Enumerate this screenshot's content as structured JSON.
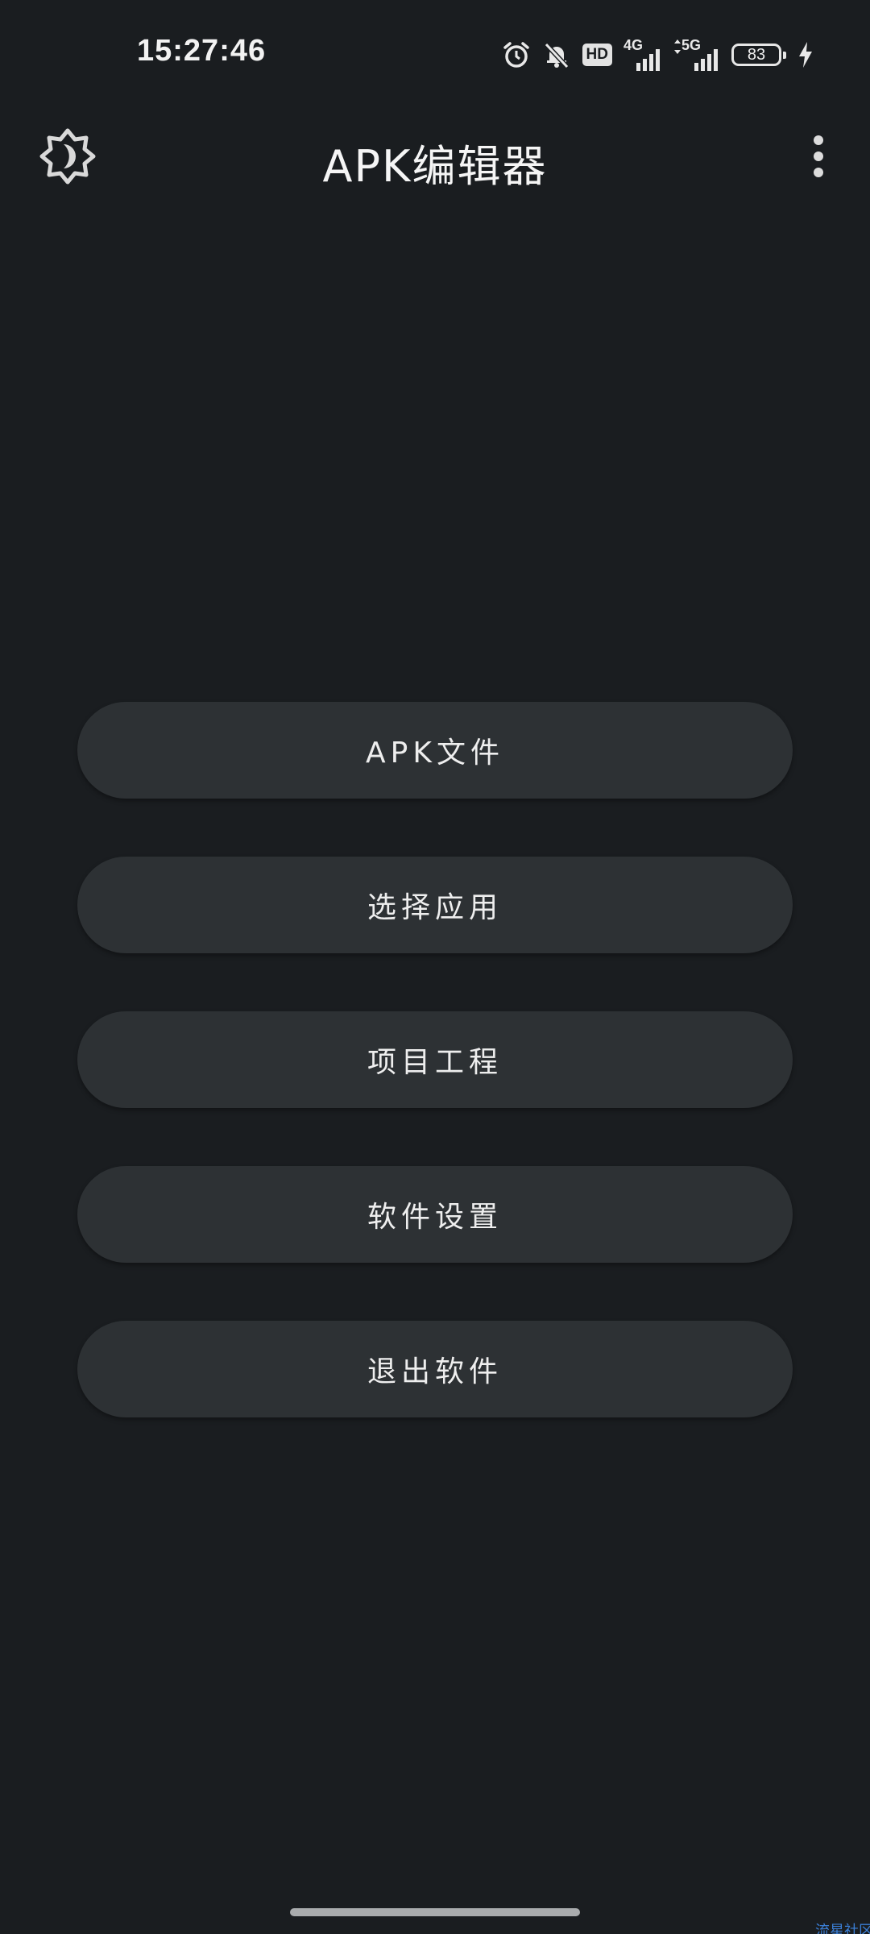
{
  "status_bar": {
    "time": "15:27:46",
    "icons": [
      "alarm-icon",
      "mute-bell-icon",
      "hd-icon",
      "signal-4g-icon",
      "signal-5g-icon",
      "battery-icon",
      "charging-icon"
    ],
    "hd_label": "HD",
    "net1": "4G",
    "net2": "5G",
    "battery_level": "83"
  },
  "app_bar": {
    "title": "APK编辑器",
    "left_icon": "theme-toggle-icon",
    "right_icon": "more-vert-icon"
  },
  "menu": {
    "items": [
      {
        "label": "APK文件"
      },
      {
        "label": "选择应用"
      },
      {
        "label": "项目工程"
      },
      {
        "label": "软件设置"
      },
      {
        "label": "退出软件"
      }
    ]
  },
  "watermark": "流星社区",
  "colors": {
    "background": "#1a1d20",
    "button": "#2d3134",
    "text": "#eeeeee",
    "watermark": "#3b7fd6"
  }
}
